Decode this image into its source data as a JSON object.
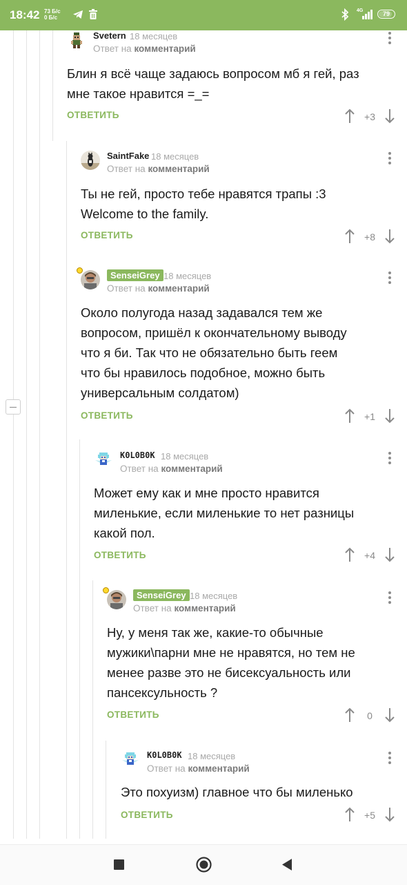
{
  "status_bar": {
    "time": "18:42",
    "net_speed_up": "73 Б/с",
    "net_speed_down": "0 Б/с",
    "network": "4G",
    "battery": "79",
    "icons": [
      "telegram-icon",
      "trash-icon",
      "bluetooth-icon",
      "signal-icon",
      "battery-icon"
    ]
  },
  "reply_to_prefix": "Ответ на",
  "reply_to_target": "комментарий",
  "reply_label": "ОТВЕТИТЬ",
  "comments": [
    {
      "username": "Svetern",
      "time": "18 месяцев",
      "lines": [
        "Блин я всё чаще задаюсь вопросом мб я гей, раз",
        "мне такое нравится =_="
      ],
      "score": "+3"
    },
    {
      "username": "SaintFake",
      "time": "18 месяцев",
      "lines": [
        "Ты не гей, просто тебе нравятся трапы :3",
        "Welcome to the family."
      ],
      "score": "+8"
    },
    {
      "username": "SenseiGrey",
      "time": "18 месяцев",
      "lines": [
        "Около полугода назад задавался тем же",
        "вопросом, пришёл к окончательному выводу",
        "что я би. Так что не обязательно быть геем",
        "что бы нравилось подобное, можно быть",
        "универсальным солдатом)"
      ],
      "score": "+1"
    },
    {
      "username": "K0L0B0K",
      "time": "18 месяцев",
      "lines": [
        "Может ему как и мне просто нравится",
        "миленькие, если миленькие то нет разницы",
        "какой пол."
      ],
      "score": "+4"
    },
    {
      "username": "SenseiGrey",
      "time": "18 месяцев",
      "lines": [
        "Ну, у меня так же, какие-то обычные",
        "мужики\\парни мне не нравятся, но тем не",
        "менее разве это не бисексуальность или",
        "пансексульность ?"
      ],
      "score": "0"
    },
    {
      "username": "K0L0B0K",
      "time": "18 месяцев",
      "lines": [
        "Это похуизм) главное что бы миленько"
      ],
      "score": "+5"
    }
  ],
  "colors": {
    "accent": "#8bb85e",
    "muted": "#a9a9a9",
    "text": "#1b1b1b"
  },
  "nav": {
    "icons": [
      "recent-apps-icon",
      "home-icon",
      "back-icon"
    ]
  }
}
